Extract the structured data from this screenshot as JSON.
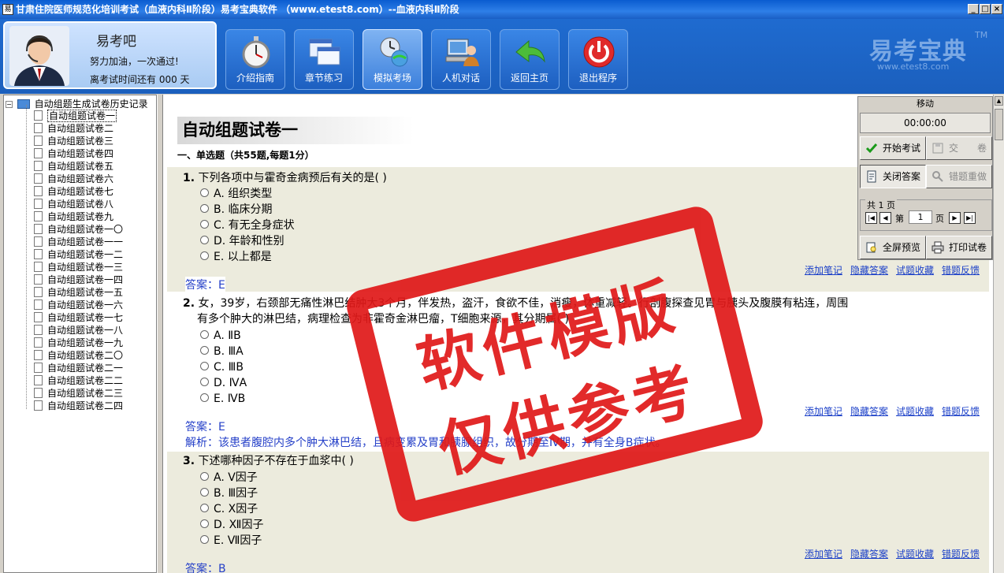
{
  "window": {
    "title": "甘肃住院医师规范化培训考试（血液内科Ⅱ阶段）易考宝典软件 （www.etest8.com）--血液内科Ⅱ阶段",
    "min": "_",
    "max": "□",
    "close": "×"
  },
  "user": {
    "name": "易考吧",
    "message": "努力加油，一次通过!",
    "days_label": "离考试时间还有 000 天"
  },
  "nav": [
    {
      "label": "介绍指南",
      "icon": "stopwatch-icon"
    },
    {
      "label": "章节练习",
      "icon": "windows-icon"
    },
    {
      "label": "模拟考场",
      "icon": "clock-globe-icon"
    },
    {
      "label": "人机对话",
      "icon": "computer-user-icon"
    },
    {
      "label": "返回主页",
      "icon": "back-arrow-icon"
    },
    {
      "label": "退出程序",
      "icon": "power-icon"
    }
  ],
  "brand": {
    "name": "易考宝典",
    "tm": "TM",
    "url": "www.etest8.com"
  },
  "tree": {
    "root": "自动组题生成试卷历史记录",
    "items": [
      "自动组题试卷一",
      "自动组题试卷二",
      "自动组题试卷三",
      "自动组题试卷四",
      "自动组题试卷五",
      "自动组题试卷六",
      "自动组题试卷七",
      "自动组题试卷八",
      "自动组题试卷九",
      "自动组题试卷一〇",
      "自动组题试卷一一",
      "自动组题试卷一二",
      "自动组题试卷一三",
      "自动组题试卷一四",
      "自动组题试卷一五",
      "自动组题试卷一六",
      "自动组题试卷一七",
      "自动组题试卷一八",
      "自动组题试卷一九",
      "自动组题试卷二〇",
      "自动组题试卷二一",
      "自动组题试卷二二",
      "自动组题试卷二三",
      "自动组题试卷二四"
    ]
  },
  "paper": {
    "title": "自动组题试卷一",
    "section": "一、单选题（共55题,每题1分）"
  },
  "questions": [
    {
      "num": "1.",
      "text": "下列各项中与霍奇金病预后有关的是( )",
      "options": [
        "A. 组织类型",
        "B. 临床分期",
        "C. 有无全身症状",
        "D. 年龄和性别",
        "E. 以上都是"
      ],
      "answer": "答案：E"
    },
    {
      "num": "2.",
      "text": "女，39岁，右颈部无痛性淋巴结肿大3个月，伴发热，盗汗，食欲不佳，消瘦，体重减轻。行剖腹探查见胃与胰头及腹膜有粘连，周围",
      "text2": "有多个肿大的淋巴结，病理检查为非霍奇金淋巴瘤，T细胞来源，其分期属(  )",
      "options": [
        "A. ⅡB",
        "B. ⅢA",
        "C. ⅢB",
        "D. ⅣA",
        "E. ⅣB"
      ],
      "answer": "答案：E",
      "analysis": "解析：该患者腹腔内多个肿大淋巴结，且病变累及胃和胰腺组织，故分期至Ⅳ期，并有全身B症状。"
    },
    {
      "num": "3.",
      "text": "下述哪种因子不存在于血浆中( )",
      "options": [
        "A. Ⅴ因子",
        "B. Ⅲ因子",
        "C. Ⅹ因子",
        "D. Ⅻ因子",
        "E. Ⅶ因子"
      ],
      "answer": "答案：B"
    }
  ],
  "links": {
    "note": "添加笔记",
    "hide": "隐藏答案",
    "fav": "试题收藏",
    "feedback": "错题反馈"
  },
  "panel": {
    "move": "移动",
    "timer": "00:00:00",
    "start": "开始考试",
    "submit": "交　　卷",
    "close_answer": "关闭答案",
    "redo": "错题重做",
    "pages": "共 1 页",
    "page_prefix": "第",
    "page_value": "1",
    "page_suffix": "页",
    "preview": "全屏预览",
    "print": "打印试卷"
  },
  "watermark": {
    "line1": "软件模版",
    "line2": "仅供参考"
  }
}
